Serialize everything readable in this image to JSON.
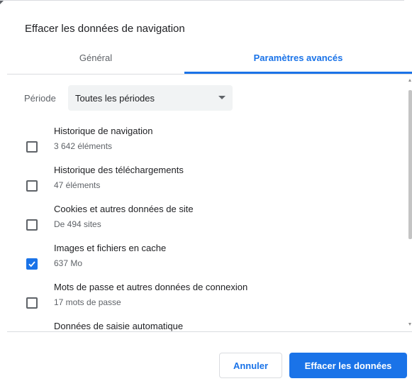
{
  "dialog": {
    "title": "Effacer les données de navigation"
  },
  "tabs": [
    {
      "label": "Général",
      "selected": false
    },
    {
      "label": "Paramètres avancés",
      "selected": true
    }
  ],
  "period": {
    "label": "Période",
    "value": "Toutes les périodes"
  },
  "items": [
    {
      "label": "Historique de navigation",
      "detail": "3 642 éléments",
      "checked": false
    },
    {
      "label": "Historique des téléchargements",
      "detail": "47 éléments",
      "checked": false
    },
    {
      "label": "Cookies et autres données de site",
      "detail": "De 494 sites",
      "checked": false
    },
    {
      "label": "Images et fichiers en cache",
      "detail": "637 Mo",
      "checked": true
    },
    {
      "label": "Mots de passe et autres données de connexion",
      "detail": "17 mots de passe",
      "checked": false
    },
    {
      "label": "Données de saisie automatique",
      "detail": "",
      "checked": false
    }
  ],
  "buttons": {
    "cancel": "Annuler",
    "clear": "Effacer les données"
  },
  "colors": {
    "accent": "#1a73e8",
    "text": "#202124",
    "secondary_text": "#5f6368",
    "divider": "#dadce0"
  }
}
